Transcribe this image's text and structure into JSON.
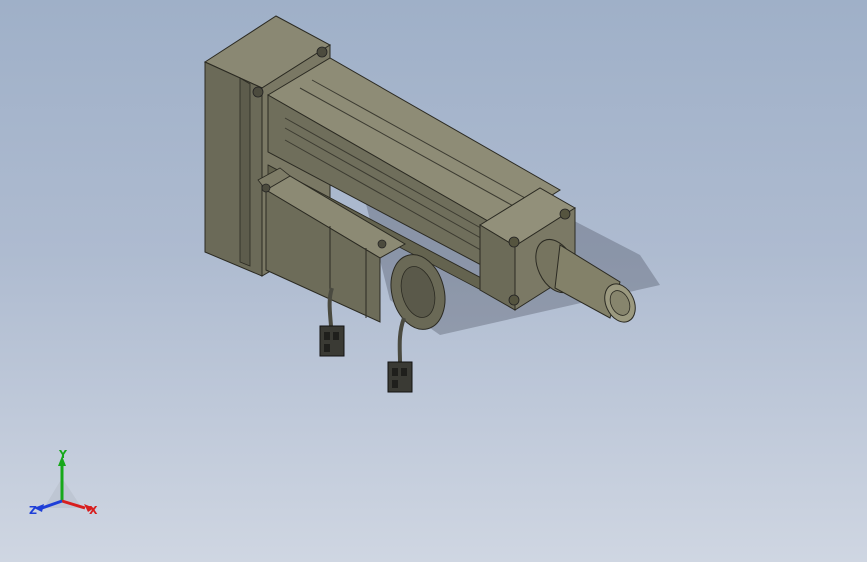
{
  "viewport": {
    "background_top": "#9fb0c8",
    "background_bottom": "#cfd6e2",
    "model": "electric-linear-actuator-with-servo-motor",
    "model_color": "#7f7d68"
  },
  "triad": {
    "x_label": "X",
    "y_label": "Y",
    "z_label": "Z",
    "x_color": "#d81e1e",
    "y_color": "#17a81a",
    "z_color": "#1e3fd8"
  }
}
